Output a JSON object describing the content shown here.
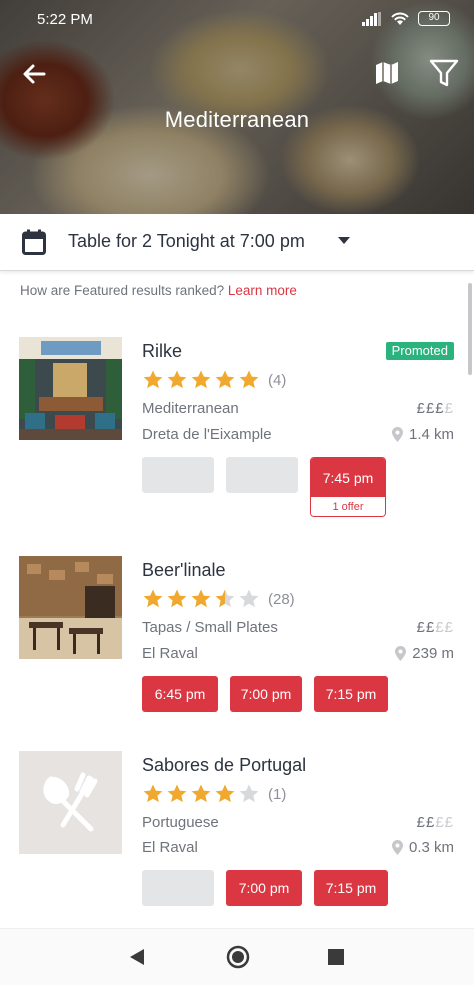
{
  "status_bar": {
    "time": "5:22 PM",
    "battery": "90"
  },
  "header": {
    "title": "Mediterranean",
    "icons": {
      "back": "arrow-left-icon",
      "map": "map-icon",
      "filter": "filter-icon"
    }
  },
  "party_bar": {
    "label": "Table for 2 Tonight at 7:00 pm",
    "icon": "calendar-icon"
  },
  "ranking_note": {
    "text": "How are Featured results ranked?",
    "link": "Learn more"
  },
  "colors": {
    "accent": "#da3743",
    "promoted": "#2bb37e",
    "star": "#f0a92e",
    "star_empty": "#d8d9db"
  },
  "restaurants": [
    {
      "name": "Rilke",
      "rating": 5,
      "reviews": "(4)",
      "cuisine": "Mediterranean",
      "price_on": "£££",
      "price_off": "£",
      "neighborhood": "Dreta de l'Eixample",
      "distance": "1.4 km",
      "badge": "Promoted",
      "slots": [
        {
          "type": "empty"
        },
        {
          "type": "empty"
        },
        {
          "type": "offer",
          "time": "7:45 pm",
          "offer": "1 offer"
        }
      ]
    },
    {
      "name": "Beer'linale",
      "rating": 3.5,
      "reviews": "(28)",
      "cuisine": "Tapas / Small Plates",
      "price_on": "££",
      "price_off": "££",
      "neighborhood": "El Raval",
      "distance": "239 m",
      "slots": [
        {
          "type": "time",
          "time": "6:45 pm"
        },
        {
          "type": "time",
          "time": "7:00 pm"
        },
        {
          "type": "time",
          "time": "7:15 pm"
        }
      ]
    },
    {
      "name": "Sabores de Portugal",
      "rating": 4,
      "reviews": "(1)",
      "cuisine": "Portuguese",
      "price_on": "££",
      "price_off": "££",
      "neighborhood": "El Raval",
      "distance": "0.3 km",
      "slots": [
        {
          "type": "empty"
        },
        {
          "type": "time",
          "time": "7:00 pm"
        },
        {
          "type": "time",
          "time": "7:15 pm"
        }
      ]
    }
  ],
  "nav_bar": {
    "icons": [
      "nav-back-icon",
      "nav-home-icon",
      "nav-recents-icon"
    ]
  }
}
